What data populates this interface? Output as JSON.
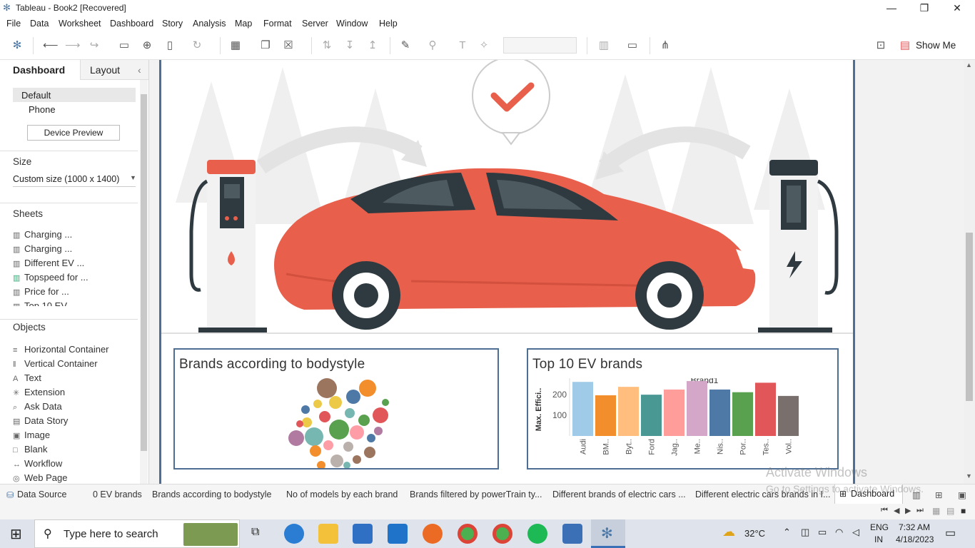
{
  "window": {
    "title": "Tableau - Book2 [Recovered]",
    "minimize": "—",
    "restore": "❐",
    "close": "✕"
  },
  "menu": [
    "File",
    "Data",
    "Worksheet",
    "Dashboard",
    "Story",
    "Analysis",
    "Map",
    "Format",
    "Server",
    "Window",
    "Help"
  ],
  "toolbar": {
    "show_me": "Show Me"
  },
  "left_pane": {
    "tabs": [
      "Dashboard",
      "Layout"
    ],
    "collapse_icon": "‹",
    "device_options": [
      "Default",
      "Phone"
    ],
    "device_preview_button": "Device Preview",
    "size_title": "Size",
    "size_value": "Custom size (1000 x 1400)",
    "sheets_title": "Sheets",
    "sheets": [
      "Charging ...",
      "Charging ...",
      "Different EV ...",
      "Topspeed for ...",
      "Price for ...",
      "Top 10 EV"
    ],
    "objects_title": "Objects",
    "objects": [
      {
        "label": "Horizontal Container",
        "icon": "≡"
      },
      {
        "label": "Vertical Container",
        "icon": "‖"
      },
      {
        "label": "Text",
        "icon": "A"
      },
      {
        "label": "Extension",
        "icon": "✳"
      },
      {
        "label": "Ask Data",
        "icon": "⌕"
      },
      {
        "label": "Data Story",
        "icon": "▤"
      },
      {
        "label": "Image",
        "icon": "▣"
      },
      {
        "label": "Blank",
        "icon": "□"
      },
      {
        "label": "Workflow",
        "icon": "↔"
      },
      {
        "label": "Web Page",
        "icon": "◎"
      }
    ]
  },
  "dashboard": {
    "bubble_panel_title": "Brands according to bodystyle",
    "bar_panel_title": "Top 10 EV brands"
  },
  "chart_data": {
    "type": "bar",
    "title": "Brand1",
    "ylabel": "Max. Effici..",
    "categories": [
      "Audi",
      "BM..",
      "Byt..",
      "Ford",
      "Jag..",
      "Me..",
      "Nis..",
      "Por..",
      "Tes..",
      "Vol.."
    ],
    "values": [
      262,
      197,
      238,
      200,
      225,
      266,
      225,
      212,
      258,
      194
    ],
    "yticks": [
      100,
      200
    ],
    "ylim": [
      0,
      280
    ],
    "colors": [
      "#a0cbe8",
      "#f28e2b",
      "#ffbe7d",
      "#499894",
      "#ff9d9a",
      "#d4a6c8",
      "#4e79a7",
      "#59a14f",
      "#e15759",
      "#79706e"
    ]
  },
  "sheet_tabs": {
    "data_source": "Data Source",
    "tabs": [
      "0 EV brands",
      "Brands according to bodystyle",
      "No of models by each brand",
      "Brands filtered by powerTrain ty...",
      "Different brands of electric cars ...",
      "Different electric cars brands in I..."
    ],
    "active": "Dashboard"
  },
  "watermark": {
    "line1": "Activate Windows",
    "line2": "Go to Settings to activate Windows."
  },
  "taskbar": {
    "search_placeholder": "Type here to search",
    "weather": "32°C",
    "lang1": "ENG",
    "lang2": "IN",
    "time": "7:32 AM",
    "date": "4/18/2023"
  }
}
